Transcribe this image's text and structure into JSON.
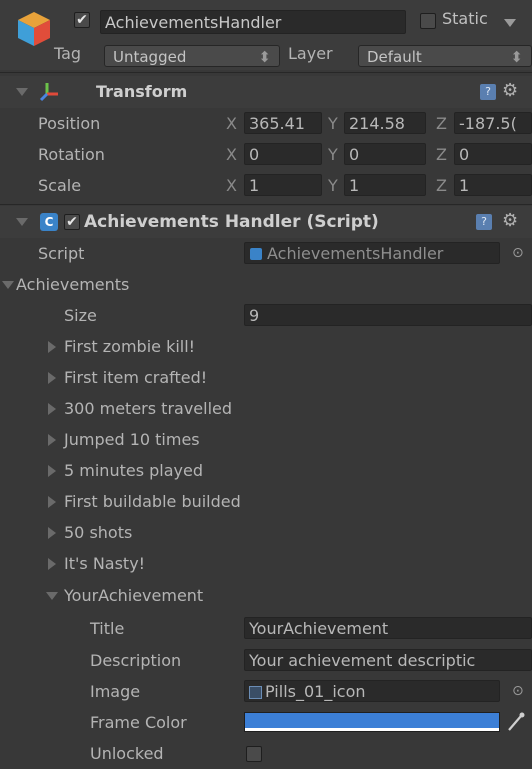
{
  "header": {
    "object_name": "AchievementsHandler",
    "static_label": "Static",
    "tag_label": "Tag",
    "tag_value": "Untagged",
    "layer_label": "Layer",
    "layer_value": "Default"
  },
  "transform": {
    "title": "Transform",
    "rows": [
      {
        "label": "Position",
        "x": "365.41",
        "y": "214.58",
        "z": "-187.5("
      },
      {
        "label": "Rotation",
        "x": "0",
        "y": "0",
        "z": "0"
      },
      {
        "label": "Scale",
        "x": "1",
        "y": "1",
        "z": "1"
      }
    ],
    "axis": {
      "x": "X",
      "y": "Y",
      "z": "Z"
    }
  },
  "script_component": {
    "title": "Achievements Handler (Script)",
    "script_label": "Script",
    "script_value": "AchievementsHandler",
    "achievements_label": "Achievements",
    "size_label": "Size",
    "size_value": "9",
    "items": [
      "First zombie kill!",
      "First item crafted!",
      "300 meters travelled",
      "Jumped 10 times",
      "5 minutes played",
      "First buildable builded",
      "50 shots",
      "It's Nasty!"
    ],
    "expanded_item": "YourAchievement",
    "fields": {
      "title_label": "Title",
      "title_value": "YourAchievement",
      "description_label": "Description",
      "description_value": "Your achievement descriptic",
      "image_label": "Image",
      "image_value": "Pills_01_icon",
      "frame_color_label": "Frame Color",
      "frame_color_value": "#3c7fd6",
      "unlocked_label": "Unlocked"
    }
  }
}
